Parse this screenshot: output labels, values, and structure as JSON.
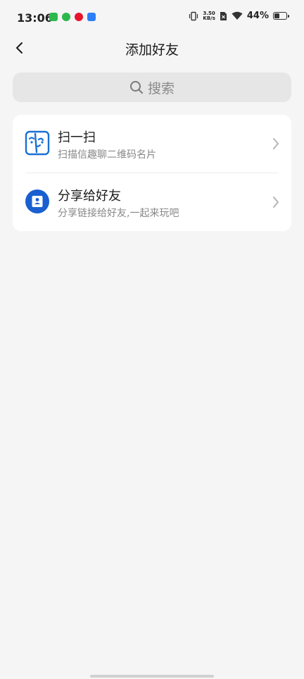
{
  "status_bar": {
    "time": "13:06",
    "net_speed_value": "3.50",
    "net_speed_unit": "KB/s",
    "battery_percent": "44%",
    "battery_level": 0.44,
    "app_icon_colors": [
      "#2db84d",
      "#2db84d",
      "#e6162d",
      "#2d7ff9"
    ]
  },
  "header": {
    "title": "添加好友"
  },
  "search": {
    "placeholder": "搜索"
  },
  "menu": {
    "items": [
      {
        "label": "扫一扫",
        "subtitle": "扫描信趣聊二维码名片",
        "icon": "scan-icon"
      },
      {
        "label": "分享给好友",
        "subtitle": "分享链接给好友,一起来玩吧",
        "icon": "contact-card-icon"
      }
    ]
  },
  "colors": {
    "accent": "#1a6fd6",
    "background": "#f5f5f5",
    "card": "#ffffff",
    "search_bg": "#e6e6e6"
  }
}
